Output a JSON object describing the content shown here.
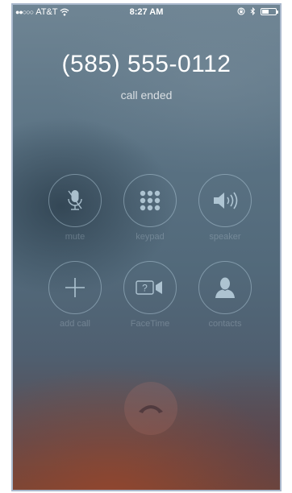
{
  "status_bar": {
    "signal_dots": "●●○○○",
    "carrier": "AT&T",
    "time": "8:27 AM",
    "battery_percent": 50
  },
  "call": {
    "number": "(585) 555-0112",
    "status": "call ended"
  },
  "controls": [
    {
      "label": "mute",
      "icon": "mic-off-icon"
    },
    {
      "label": "keypad",
      "icon": "keypad-icon"
    },
    {
      "label": "speaker",
      "icon": "speaker-icon"
    },
    {
      "label": "add call",
      "icon": "plus-icon"
    },
    {
      "label": "FaceTime",
      "icon": "facetime-icon"
    },
    {
      "label": "contacts",
      "icon": "contact-icon"
    }
  ],
  "end_call": {
    "icon": "end-call-icon"
  },
  "colors": {
    "icon_stroke": "#c5dbe8",
    "text_primary": "#ffffff"
  }
}
